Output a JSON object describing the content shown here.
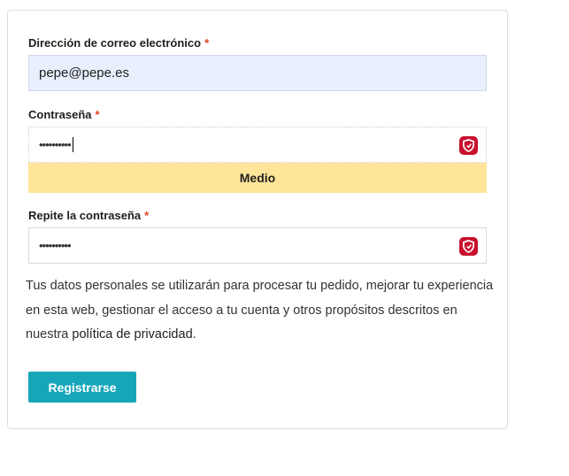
{
  "form": {
    "email_label": "Dirección de correo electrónico",
    "email_value": "pepe@pepe.es",
    "password_label": "Contraseña",
    "password_value": "••••••••••",
    "strength_label": "Medio",
    "repeat_label": "Repite la contraseña",
    "repeat_value": "••••••••••",
    "required_mark": "*",
    "privacy_text": "Tus datos personales se utilizarán para procesar tu pedido, mejorar tu experiencia en esta web, gestionar el acceso a tu cuenta y otros propósitos descritos en nuestra ",
    "privacy_link": "política de privacidad",
    "privacy_end": ".",
    "submit_label": "Registrarse"
  },
  "colors": {
    "accent": "#17a6b9",
    "strength_medium": "#ffe599",
    "autofill_bg": "#e8f0fe",
    "required": "#e2401c",
    "password_manager_icon": "#c8102e"
  },
  "icons": {
    "password_manager": "password-manager-icon"
  }
}
